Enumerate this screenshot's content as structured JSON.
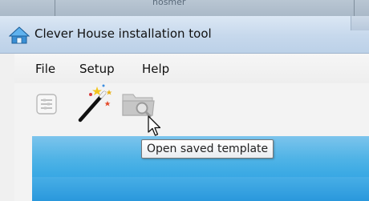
{
  "background_window": {
    "label": "hosmer"
  },
  "window": {
    "title": "Clever House installation tool"
  },
  "menu": [
    {
      "label": "File"
    },
    {
      "label": "Setup"
    },
    {
      "label": "Help"
    }
  ],
  "toolbar": {
    "buttons": [
      {
        "icon": "settings-list-icon",
        "state": "disabled"
      },
      {
        "icon": "magic-wand-icon",
        "state": "enabled"
      },
      {
        "icon": "folder-search-icon",
        "state": "disabled"
      }
    ]
  },
  "tooltip": {
    "text": "Open saved template"
  },
  "colors": {
    "titlebar": "#c6d8ec",
    "hero_blue": "#3aa9e4",
    "tooltip_border": "#767676"
  }
}
